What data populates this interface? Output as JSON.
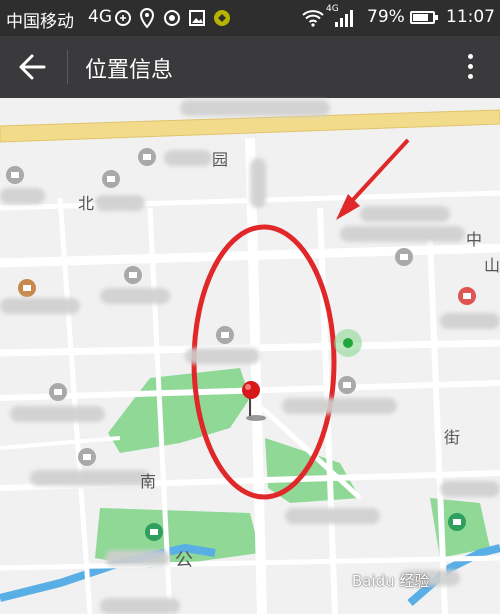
{
  "status_bar": {
    "carrier": "中国移动",
    "network": "4G",
    "network_small": "4G",
    "battery_percent": "79%",
    "battery_level": 0.79,
    "time": "11:07",
    "icons": [
      "data-saver-icon",
      "location-icon",
      "sync-icon",
      "image-icon",
      "app-icon",
      "wifi-icon",
      "signal-icon",
      "battery-icon"
    ]
  },
  "toolbar": {
    "title": "位置信息",
    "back_icon": "arrow-left-icon",
    "menu_icon": "more-vertical-icon"
  },
  "map": {
    "labels": {
      "park_suffix": "园",
      "north_char": "北",
      "street_char": "街",
      "middle_char": "中",
      "mountain_char": "山",
      "park_char": "公",
      "south_char": "南"
    },
    "watermark": "Baidu 经验",
    "colors": {
      "road": "#ffffff",
      "park": "#8fd896",
      "highway": "#f2dc8c",
      "water": "#5aaee6",
      "annotation": "#e0282a",
      "pin": "#d7191c"
    }
  }
}
